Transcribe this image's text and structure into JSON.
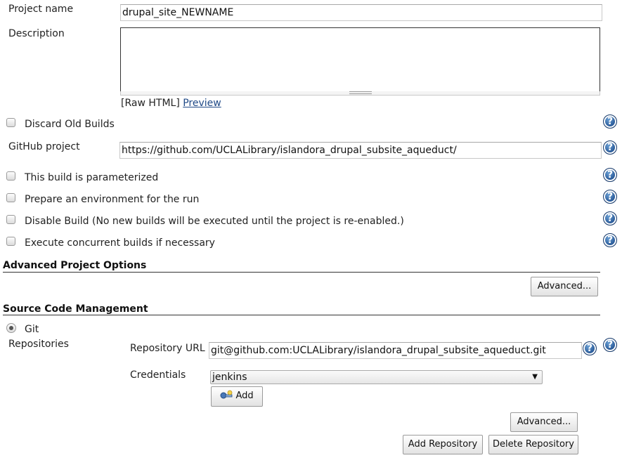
{
  "project_name": {
    "label": "Project name",
    "value": "drupal_site_NEWNAME"
  },
  "description": {
    "label": "Description",
    "value": "",
    "raw_html": "[Raw HTML]",
    "preview_link": "Preview"
  },
  "discard_old_builds": {
    "label": "Discard Old Builds",
    "checked": false
  },
  "github_project": {
    "label": "GitHub project",
    "value": "https://github.com/UCLALibrary/islandora_drupal_subsite_aqueduct/"
  },
  "options": {
    "parameterized": "This build is parameterized",
    "prepare_env": "Prepare an environment for the run",
    "disable_build": "Disable Build (No new builds will be executed until the project is re-enabled.)",
    "concurrent": "Execute concurrent builds if necessary"
  },
  "advanced_project_options": {
    "title": "Advanced Project Options",
    "advanced_button": "Advanced..."
  },
  "scm": {
    "title": "Source Code Management",
    "git_label": "Git",
    "git_selected": true,
    "repositories_label": "Repositories",
    "repository_url_label": "Repository URL",
    "repository_url_value": "git@github.com:UCLALibrary/islandora_drupal_subsite_aqueduct.git",
    "credentials_label": "Credentials",
    "credentials_value": "jenkins",
    "add_button": "Add",
    "advanced_button": "Advanced...",
    "add_repository_button": "Add Repository",
    "delete_repository_button": "Delete Repository"
  },
  "help_glyph": "?",
  "colors": {
    "link": "#204a87",
    "help": "#1f4f8f"
  }
}
